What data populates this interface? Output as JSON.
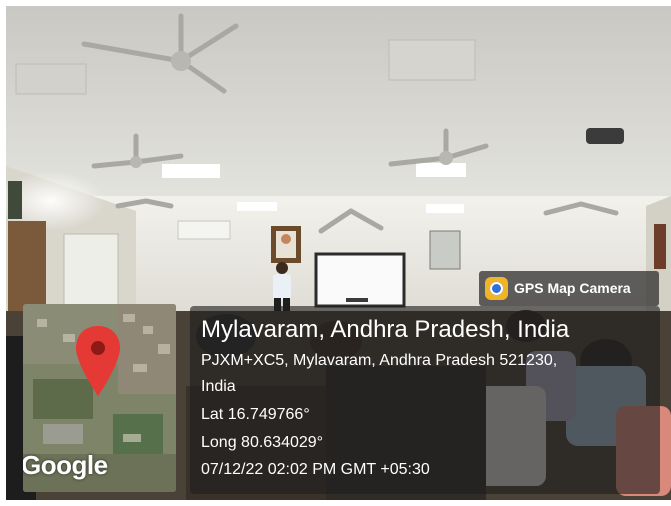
{
  "badge": {
    "title": "GPS Map Camera",
    "icon": "gps-map-camera-icon",
    "icon_color": "#f0b429"
  },
  "location": {
    "title": "Mylavaram, Andhra Pradesh, India",
    "address_line1": "PJXM+XC5, Mylavaram, Andhra Pradesh 521230,",
    "address_line2": "India",
    "latitude": "Lat 16.749766°",
    "longitude": "Long 80.634029°",
    "timestamp": "07/12/22 02:02 PM GMT +05:30"
  },
  "map": {
    "brand": "Google",
    "pin_color": "#e53935"
  }
}
